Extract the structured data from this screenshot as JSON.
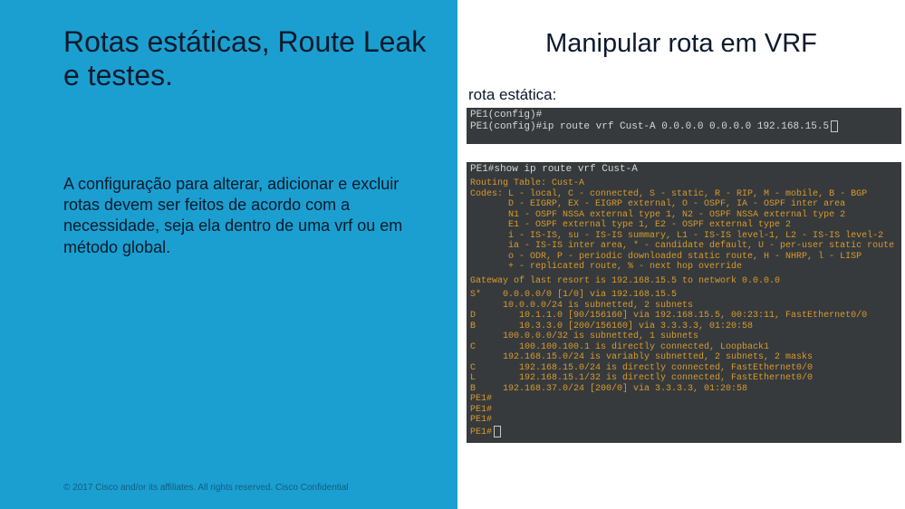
{
  "left": {
    "title": "Rotas estáticas, Route Leak e testes.",
    "body": "A configuração para alterar, adicionar e excluir rotas devem ser feitos de acordo com a necessidade, seja ela dentro de uma vrf ou em método global.",
    "footer": "© 2017  Cisco and/or its affiliates. All rights reserved.   Cisco Confidential"
  },
  "right": {
    "title": "Manipular rota em VRF",
    "sub": "rota estática:"
  },
  "term1": {
    "lines": [
      {
        "cls": "prompt",
        "text": "PE1(config)#"
      },
      {
        "cls": "cmd",
        "text": "PE1(config)#ip route vrf Cust-A 0.0.0.0 0.0.0.0 192.168.15.5",
        "cursor": true
      }
    ]
  },
  "term2": {
    "show_cmd": "PE1#show ip route vrf Cust-A",
    "header": [
      "Routing Table: Cust-A",
      "Codes: L - local, C - connected, S - static, R - RIP, M - mobile, B - BGP",
      "       D - EIGRP, EX - EIGRP external, O - OSPF, IA - OSPF inter area",
      "       N1 - OSPF NSSA external type 1, N2 - OSPF NSSA external type 2",
      "       E1 - OSPF external type 1, E2 - OSPF external type 2",
      "       i - IS-IS, su - IS-IS summary, L1 - IS-IS level-1, L2 - IS-IS level-2",
      "       ia - IS-IS inter area, * - candidate default, U - per-user static route",
      "       o - ODR, P - periodic downloaded static route, H - NHRP, l - LISP",
      "       + - replicated route, % - next hop override"
    ],
    "gateway": "Gateway of last resort is 192.168.15.5 to network 0.0.0.0",
    "routes": [
      "S*    0.0.0.0/0 [1/0] via 192.168.15.5",
      "      10.0.0.0/24 is subnetted, 2 subnets",
      "D        10.1.1.0 [90/156160] via 192.168.15.5, 00:23:11, FastEthernet0/0",
      "B        10.3.3.0 [200/156160] via 3.3.3.3, 01:20:58",
      "      100.0.0.0/32 is subnetted, 1 subnets",
      "C        100.100.100.1 is directly connected, Loopback1",
      "      192.168.15.0/24 is variably subnetted, 2 subnets, 2 masks",
      "C        192.168.15.0/24 is directly connected, FastEthernet0/0",
      "L        192.168.15.1/32 is directly connected, FastEthernet0/0",
      "B     192.168.37.0/24 [200/0] via 3.3.3.3, 01:20:58"
    ],
    "tail": [
      "PE1#",
      "PE1#",
      "PE1#",
      "PE1#"
    ]
  }
}
